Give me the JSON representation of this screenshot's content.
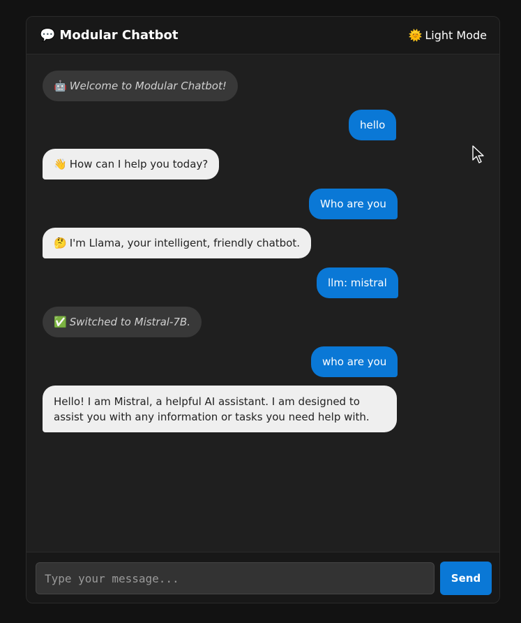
{
  "header": {
    "title_icon": "💬",
    "title": "Modular Chatbot",
    "mode_icon": "🌞",
    "mode_label": "Light Mode"
  },
  "messages": [
    {
      "role": "system",
      "emoji": "🤖",
      "text": "Welcome to Modular Chatbot!"
    },
    {
      "role": "user",
      "text": "hello"
    },
    {
      "role": "bot",
      "emoji": "👋",
      "text": "How can I help you today?"
    },
    {
      "role": "user",
      "text": "Who are you"
    },
    {
      "role": "bot",
      "emoji": "🤔",
      "text": "I'm Llama, your intelligent, friendly chatbot."
    },
    {
      "role": "user",
      "text": "llm: mistral"
    },
    {
      "role": "system",
      "emoji": "✅",
      "text": "Switched to Mistral-7B."
    },
    {
      "role": "user",
      "text": "who are you"
    },
    {
      "role": "bot",
      "text": "Hello! I am Mistral, a helpful AI assistant. I am designed to assist you with any information or tasks you need help with."
    }
  ],
  "input": {
    "placeholder": "Type your message...",
    "value": ""
  },
  "send_label": "Send",
  "colors": {
    "accent": "#0a78d6",
    "background": "#121212",
    "panel": "#1f1f1f",
    "bot_bubble": "#efefef",
    "system_bubble": "#383838"
  }
}
